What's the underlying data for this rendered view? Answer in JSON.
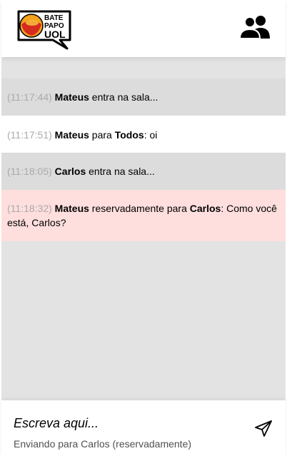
{
  "header": {
    "logo_line1": "BATE",
    "logo_line2": "PAPO",
    "logo_line3": "UOL",
    "participants_icon": "people-icon"
  },
  "messages": [
    {
      "type": "status",
      "time": "(11:17:44)",
      "from": "Mateus",
      "text": "entra na sala..."
    },
    {
      "type": "normal",
      "time": "(11:17:51)",
      "from": "Mateus",
      "connector": "para",
      "to": "Todos",
      "text": ": oi"
    },
    {
      "type": "status",
      "time": "(11:18:05)",
      "from": "Carlos",
      "text": "entra na sala..."
    },
    {
      "type": "private",
      "time": "(11:18:32)",
      "from": "Mateus",
      "connector": "reservadamente para",
      "to": "Carlos",
      "text": ": Como você está, Carlos?"
    }
  ],
  "footer": {
    "input_placeholder": "Escreva aqui...",
    "sending_to": "Enviando para Carlos (reservadamente)",
    "send_icon": "send-icon"
  },
  "colors": {
    "status_bg": "#dcdcdc",
    "normal_bg": "#ffffff",
    "private_bg": "#ffdede",
    "timestamp": "#aaaaaa"
  }
}
